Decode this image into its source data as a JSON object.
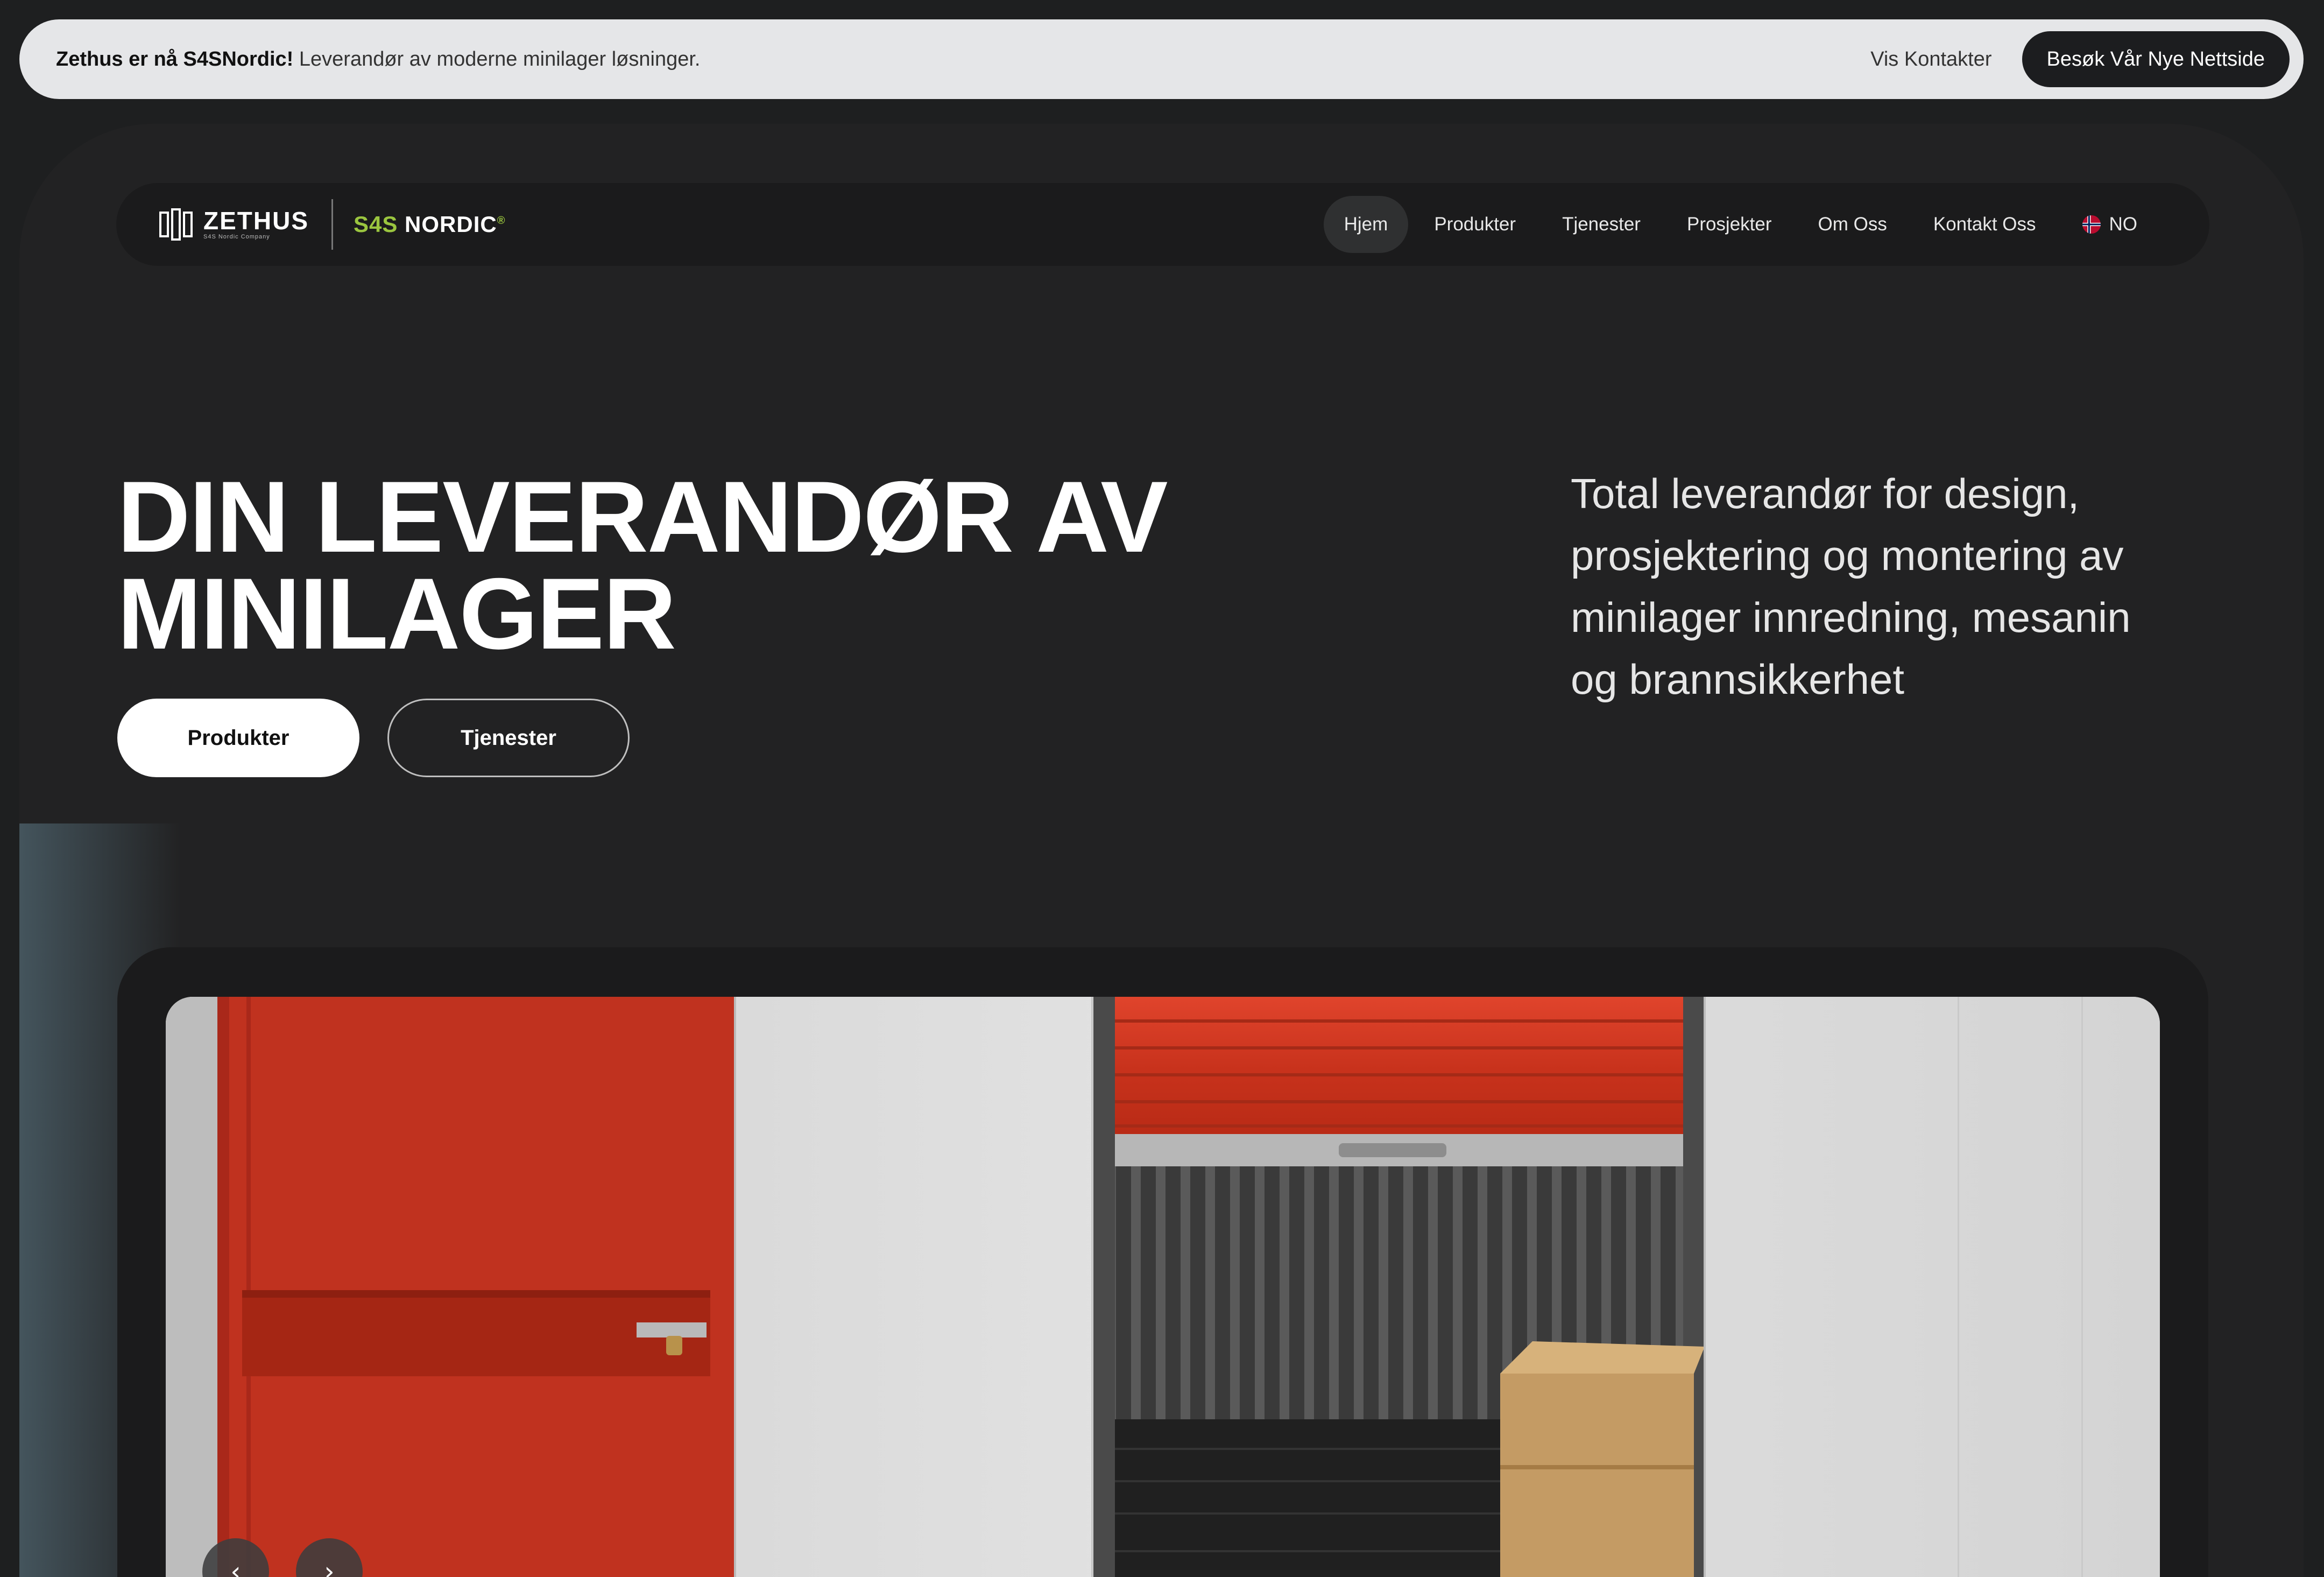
{
  "announcement": {
    "brand_text": "Zethus er nå S4SNordic!",
    "message": " Leverandør av moderne minilager løsninger.",
    "contacts_link": "Vis Kontakter",
    "visit_button": "Besøk Vår Nye Nettside"
  },
  "logo": {
    "zethus_name": "ZETHUS",
    "zethus_sub": "S4S Nordic Company",
    "s4s_prefix": "S4S",
    "s4s_name": " NORDIC",
    "s4s_mark": "®"
  },
  "nav": {
    "items": [
      {
        "label": "Hjem",
        "active": true
      },
      {
        "label": "Produkter"
      },
      {
        "label": "Tjenester"
      },
      {
        "label": "Prosjekter"
      },
      {
        "label": "Om Oss"
      },
      {
        "label": "Kontakt Oss"
      }
    ],
    "language": "NO"
  },
  "hero": {
    "title_line1": "DIN LEVERANDØR AV",
    "title_line2": "MINILAGER",
    "primary_button": "Produkter",
    "secondary_button": "Tjenester",
    "description": "Total leverandør for design, prosjektering og montering av minilager innredning, mesanin og brannsikkerhet"
  },
  "carousel": {
    "prev_icon": "chevron-left-icon",
    "next_icon": "chevron-right-icon",
    "prev_glyph": "‹",
    "next_glyph": "›"
  },
  "colors": {
    "background": "#1e1f20",
    "card": "#222223",
    "accent_green": "#9ac53f",
    "door_red": "#c0321f"
  }
}
